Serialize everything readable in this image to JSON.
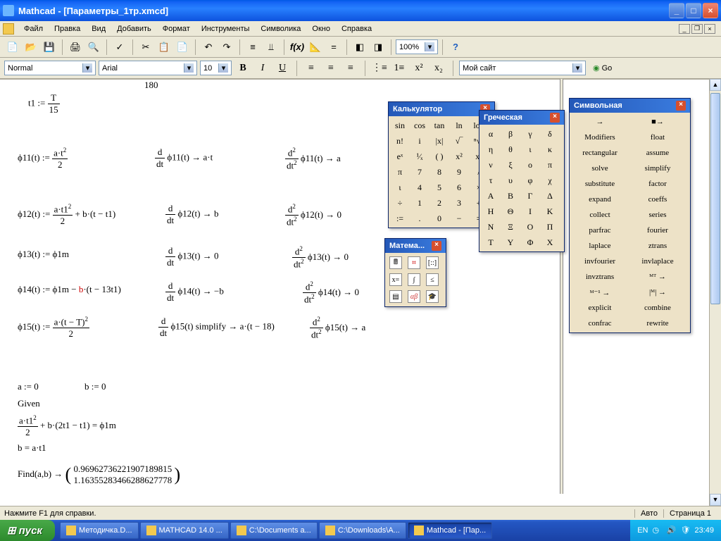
{
  "window": {
    "title": "Mathcad - [Параметры_1тр.xmcd]"
  },
  "menu": {
    "file": "Файл",
    "edit": "Правка",
    "view": "Вид",
    "insert": "Добавить",
    "format": "Формат",
    "tools": "Инструменты",
    "symbolics": "Символика",
    "window": "Окно",
    "help": "Справка"
  },
  "toolbar": {
    "zoom": "100%"
  },
  "format": {
    "style": "Normal",
    "font": "Arial",
    "size": "10",
    "mysite": "Мой сайт",
    "go": "Go"
  },
  "palettes": {
    "calc": {
      "title": "Калькулятор",
      "rows": [
        [
          "sin",
          "cos",
          "tan",
          "ln",
          "log"
        ],
        [
          "n!",
          "i",
          "|x|",
          "√‾",
          "ⁿ√‾"
        ],
        [
          "eˣ",
          "¹⁄ₓ",
          "( )",
          "x²",
          "xʸ"
        ],
        [
          "π",
          "7",
          "8",
          "9",
          "/"
        ],
        [
          "ι",
          "4",
          "5",
          "6",
          "×"
        ],
        [
          "÷",
          "1",
          "2",
          "3",
          "+"
        ],
        [
          ":=",
          ".",
          "0",
          "−",
          "="
        ]
      ]
    },
    "greek": {
      "title": "Греческая",
      "rows": [
        [
          "α",
          "β",
          "γ",
          "δ"
        ],
        [
          "η",
          "θ",
          "ι",
          "κ"
        ],
        [
          "ν",
          "ξ",
          "ο",
          "π"
        ],
        [
          "τ",
          "υ",
          "φ",
          "χ"
        ],
        [
          "A",
          "B",
          "Γ",
          "Δ"
        ],
        [
          "H",
          "Θ",
          "I",
          "K"
        ],
        [
          "N",
          "Ξ",
          "O",
          "Π"
        ],
        [
          "T",
          "Y",
          "Φ",
          "X"
        ]
      ]
    },
    "sym": {
      "title": "Символьная",
      "rows": [
        [
          "→",
          "■→"
        ],
        [
          "Modifiers",
          "float"
        ],
        [
          "rectangular",
          "assume"
        ],
        [
          "solve",
          "simplify"
        ],
        [
          "substitute",
          "factor"
        ],
        [
          "expand",
          "coeffs"
        ],
        [
          "collect",
          "series"
        ],
        [
          "parfrac",
          "fourier"
        ],
        [
          "laplace",
          "ztrans"
        ],
        [
          "invfourier",
          "invlaplace"
        ],
        [
          "invztrans",
          "ᴹᵀ →"
        ],
        [
          "ᴹ⁻¹ →",
          "|ᴹ| →"
        ],
        [
          "explicit",
          "combine"
        ],
        [
          "confrac",
          "rewrite"
        ]
      ]
    },
    "math": {
      "title": "Матема..."
    }
  },
  "math": {
    "t1": "t1 :=",
    "t1frac_num": "T",
    "t1frac_den": "15",
    "e180": "180",
    "phi11_lhs": "ϕ11(t) := ",
    "phi11_num": "a·t",
    "phi11_den": "2",
    "phi11_sup": "2",
    "phi11_d1": "ϕ11(t) → a·t",
    "phi11_d2": "ϕ11(t) → a",
    "phi12_lhs": "ϕ12(t) := ",
    "phi12_num": "a·t1",
    "phi12_sup": "2",
    "phi12_den": "2",
    "phi12_tail": " + b·(t − t1)",
    "phi12_d1": "ϕ12(t) → b",
    "phi12_d2": "ϕ12(t) → 0",
    "phi13": "ϕ13(t) := ϕ1m",
    "phi13_d1": "ϕ13(t) → 0",
    "phi13_d2": "ϕ13(t) → 0",
    "phi14": "ϕ14(t) := ϕ1m − ",
    "phi14_b": "b",
    "phi14_tail": "·(t − 13t1)",
    "phi14_d1": "ϕ14(t) → −b",
    "phi14_d2": "ϕ14(t) → 0",
    "phi15_lhs": "ϕ15(t) := ",
    "phi15_num": "a·(t − T)",
    "phi15_sup": "2",
    "phi15_den": "2",
    "phi15_d1": "ϕ15(t) simplify → a·(t − 18)",
    "phi15_d2": "ϕ15(t) → a",
    "a0": "a := 0",
    "b0": "b := 0",
    "given": "Given",
    "g1_num": "a·t1",
    "g1_sup": "2",
    "g1_den": "2",
    "g1_tail": " + b·(2t1 − t1) = ϕ1m",
    "g2": "b = a·t1",
    "find": "Find(a,b) → ",
    "res1": "0.96962736221907189815",
    "res2": "1.16355283466288627778",
    "dd": "d",
    "dt": "dt"
  },
  "status": {
    "hint": "Нажмите F1 для справки.",
    "auto": "Авто",
    "page": "Страница 1"
  },
  "taskbar": {
    "start": "пуск",
    "tasks": [
      {
        "label": "Методичка.D..."
      },
      {
        "label": "MATHCAD 14.0 ..."
      },
      {
        "label": "C:\\Documents a..."
      },
      {
        "label": "C:\\Downloads\\A..."
      },
      {
        "label": "Mathcad - [Пар...",
        "active": true
      }
    ],
    "lang": "EN",
    "time": "23:49"
  }
}
